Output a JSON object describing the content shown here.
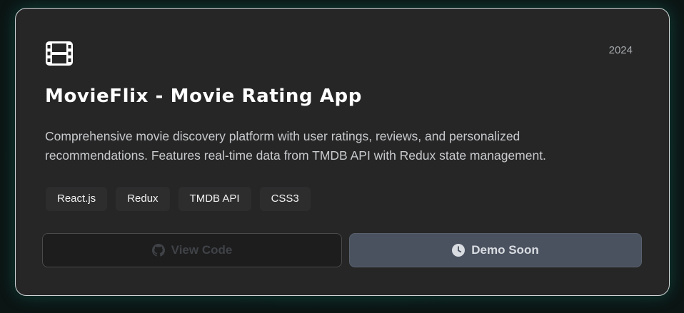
{
  "card": {
    "icon": "film-icon",
    "year": "2024",
    "title": "MovieFlix - Movie Rating App",
    "description": "Comprehensive movie discovery platform with user ratings, reviews, and personalized recommendations. Features real-time data from TMDB API with Redux state management.",
    "tags": [
      "React.js",
      "Redux",
      "TMDB API",
      "CSS3"
    ]
  },
  "buttons": {
    "view_code": {
      "label": "View Code",
      "icon": "github-icon"
    },
    "demo": {
      "label": "Demo Soon",
      "icon": "clock-icon"
    }
  },
  "colors": {
    "card_background": "#262626",
    "card_border": "#cfd4d6",
    "glow": "#1e9682",
    "demo_button": "#4a5260"
  }
}
